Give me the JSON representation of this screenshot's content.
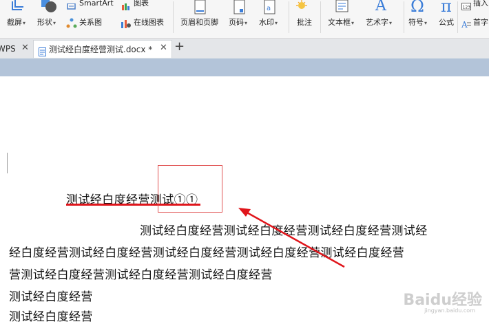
{
  "ribbon": {
    "screenshot": "截屏",
    "shapes": "形状",
    "smartart": "SmartArt",
    "chart": "图表",
    "relation": "关系图",
    "online_chart": "在线图表",
    "header_footer": "页眉和页脚",
    "page_number": "页码",
    "watermark": "水印",
    "comment": "批注",
    "textbox": "文本框",
    "wordart": "艺术字",
    "symbol": "符号",
    "formula": "公式",
    "insert": "插入",
    "first_letter": "首字",
    "symbol_glyph": "Ω",
    "formula_glyph": "π",
    "wordart_glyph": "A"
  },
  "tabs": {
    "wps_tab": "WPS",
    "doc_tab": "测试经白度经营测试.docx *"
  },
  "document": {
    "title_line": "测试经白度经营测试①①",
    "line1": "测试经白度经营测试经白度经营测试经白度经营测试经",
    "line2": "经白度经营测试经白度经营测试经白度经营测试经白度经营测试经白度经营",
    "line3": "营测试经白度经营测试经白度经营测试经白度经营",
    "line4": "测试经白度经营",
    "line5": "测试经白度经营"
  },
  "watermark": {
    "brand": "Baidu经验",
    "url": "jingyan.baidu.com"
  },
  "colors": {
    "annotation_red": "#e0151b",
    "band_blue": "#b3c4d9"
  }
}
